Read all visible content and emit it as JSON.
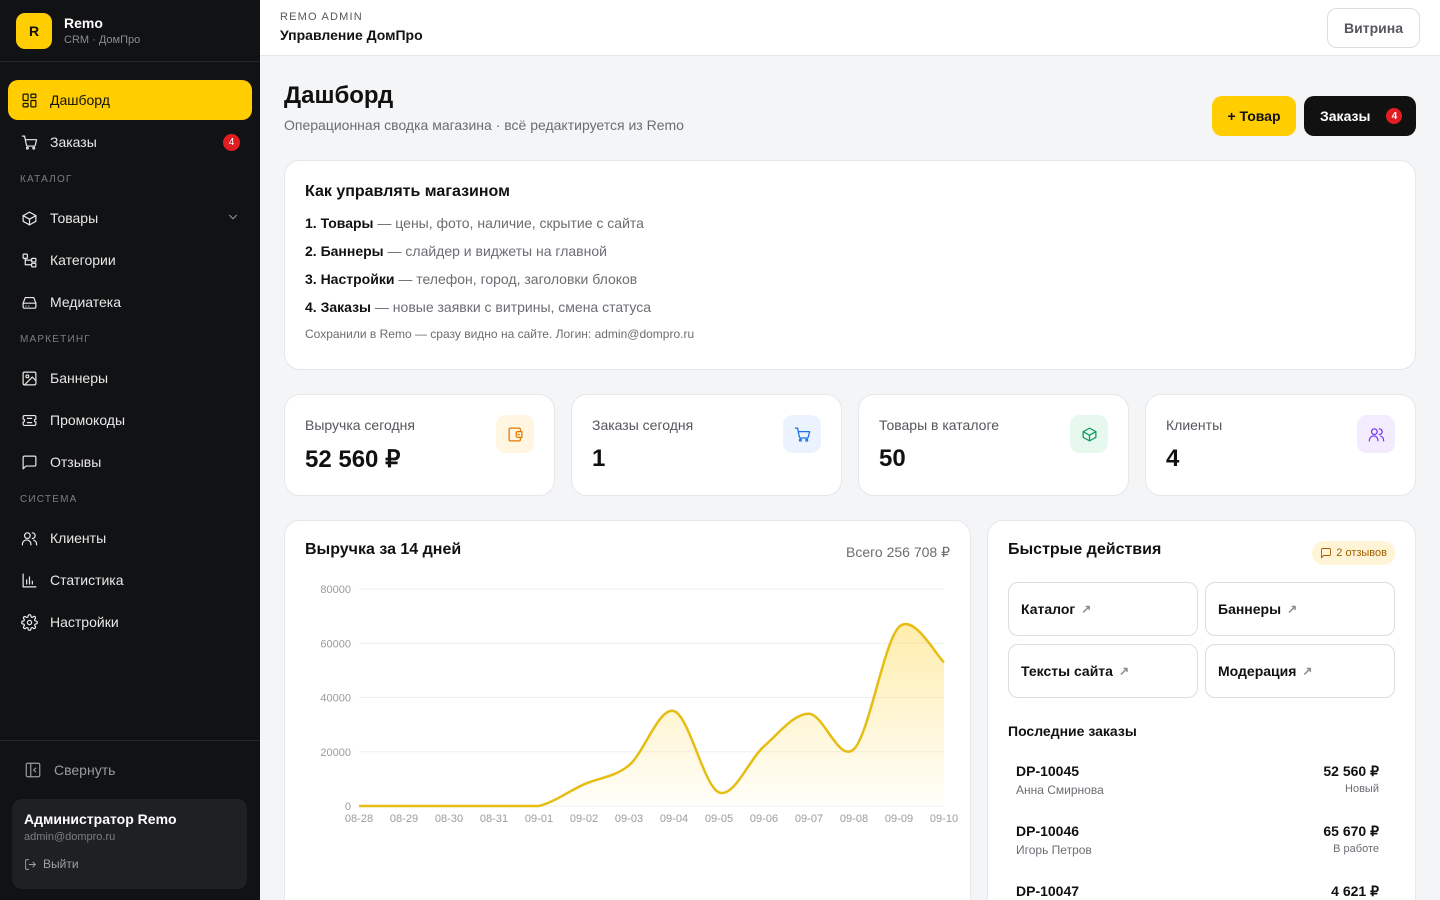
{
  "brand": {
    "logo_letter": "R",
    "name": "Remo",
    "sub": "CRM · ДомПро"
  },
  "sidebar": {
    "items_top": [
      {
        "label": "Дашборд",
        "icon": "dashboard-icon"
      },
      {
        "label": "Заказы",
        "icon": "cart-icon",
        "badge": "4"
      }
    ],
    "section_catalog": "КАТАЛОГ",
    "items_catalog": [
      {
        "label": "Товары",
        "icon": "box-icon"
      },
      {
        "label": "Категории",
        "icon": "tree-icon"
      },
      {
        "label": "Медиатека",
        "icon": "drive-icon"
      }
    ],
    "section_marketing": "МАРКЕТИНГ",
    "items_marketing": [
      {
        "label": "Баннеры",
        "icon": "image-icon"
      },
      {
        "label": "Промокоды",
        "icon": "ticket-icon"
      },
      {
        "label": "Отзывы",
        "icon": "message-icon"
      }
    ],
    "section_system": "СИСТЕМА",
    "items_system": [
      {
        "label": "Клиенты",
        "icon": "users-icon"
      },
      {
        "label": "Статистика",
        "icon": "bar-chart-icon"
      },
      {
        "label": "Настройки",
        "icon": "gear-icon"
      }
    ],
    "collapse_label": "Свернуть",
    "user": {
      "name": "Администратор Remo",
      "email": "admin@dompro.ru",
      "logout": "Выйти"
    }
  },
  "topbar": {
    "kicker": "REMO ADMIN",
    "title": "Управление ДомПро",
    "storefront_label": "Витрина"
  },
  "page": {
    "title": "Дашборд",
    "subtitle": "Операционная сводка магазина · всё редактируется из Remo",
    "add_label": "+ Товар",
    "orders_label": "Заказы",
    "orders_badge": "4"
  },
  "howto": {
    "title": "Как управлять магазином",
    "steps": [
      {
        "name": "1. Товары",
        "desc": " — цены, фото, наличие, скрытие с сайта"
      },
      {
        "name": "2. Баннеры",
        "desc": " — слайдер и виджеты на главной"
      },
      {
        "name": "3. Настройки",
        "desc": " — телефон, город, заголовки блоков"
      },
      {
        "name": "4. Заказы",
        "desc": " — новые заявки с витрины, смена статуса"
      }
    ],
    "note": "Сохранили в Remo — сразу видно на сайте. Логин: admin@dompro.ru"
  },
  "stats": [
    {
      "label": "Выручка сегодня",
      "value": "52 560 ₽",
      "icon": "wallet-icon",
      "color": "#e57a00",
      "bg": "#fff5e0"
    },
    {
      "label": "Заказы сегодня",
      "value": "1",
      "icon": "cart-icon",
      "color": "#1a73e8",
      "bg": "#eaf3fe"
    },
    {
      "label": "Товары в каталоге",
      "value": "50",
      "icon": "box-icon",
      "color": "#0f9b5f",
      "bg": "#e7f8ef"
    },
    {
      "label": "Клиенты",
      "value": "4",
      "icon": "users-icon",
      "color": "#7c3aed",
      "bg": "#f2ecfe"
    }
  ],
  "revenue": {
    "title": "Выручка за 14 дней",
    "total": "Всего 256 708 ₽"
  },
  "chart_data": {
    "type": "area",
    "x": [
      "08-28",
      "08-29",
      "08-30",
      "08-31",
      "09-01",
      "09-02",
      "09-03",
      "09-04",
      "09-05",
      "09-06",
      "09-07",
      "09-08",
      "09-09",
      "09-10"
    ],
    "values": [
      0,
      0,
      0,
      0,
      0,
      8000,
      15000,
      35000,
      5000,
      22000,
      34000,
      21000,
      66000,
      53000
    ],
    "yticks": [
      0,
      20000,
      40000,
      60000,
      80000
    ],
    "ylim": [
      0,
      80000
    ],
    "grid": true,
    "color": "#e6bd12"
  },
  "quick": {
    "title": "Быстрые действия",
    "reviews_badge": "2 отзывов",
    "buttons": [
      "Каталог",
      "Баннеры",
      "Тексты сайта",
      "Модерация"
    ],
    "arrow": "↗",
    "recent_title": "Последние заказы",
    "orders": [
      {
        "id": "DP-10045",
        "name": "Анна Смирнова",
        "sum": "52 560 ₽",
        "status": "Новый"
      },
      {
        "id": "DP-10046",
        "name": "Игорь Петров",
        "sum": "65 670 ₽",
        "status": "В работе"
      },
      {
        "id": "DP-10047",
        "name": "",
        "sum": "4 621 ₽",
        "status": ""
      }
    ]
  }
}
